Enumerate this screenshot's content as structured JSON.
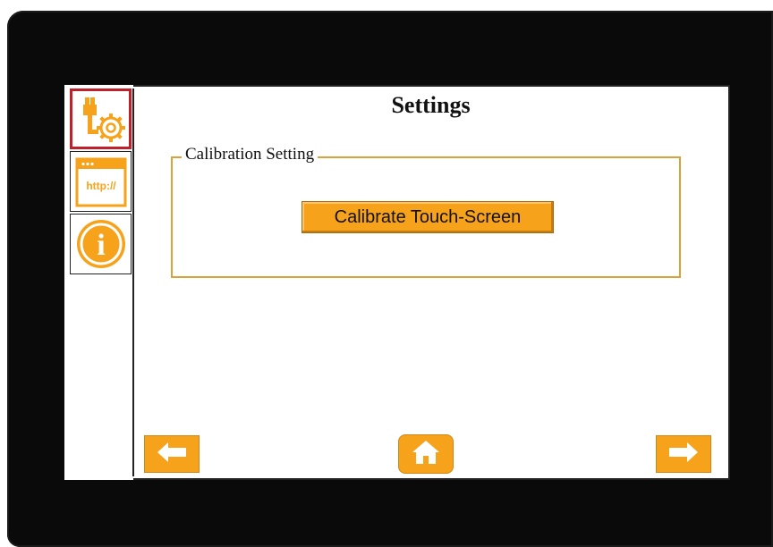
{
  "screen": {
    "title": "Settings"
  },
  "sidebar": {
    "items": [
      {
        "id": "settings",
        "icon": "settings-gear-icon",
        "active": true
      },
      {
        "id": "network",
        "icon": "browser-window-icon",
        "label": "http://",
        "active": false
      },
      {
        "id": "info",
        "icon": "info-icon",
        "label": "i",
        "active": false
      }
    ]
  },
  "calibration": {
    "group_label": "Calibration Setting",
    "button_label": "Calibrate Touch-Screen"
  },
  "navigation": {
    "back_icon": "arrow-left-icon",
    "home_icon": "home-icon",
    "next_icon": "arrow-right-icon"
  },
  "colors": {
    "accent": "#f7a21b",
    "active_border": "#c0202a",
    "group_border": "#d9a23a",
    "bezel": "#0a0a0a"
  }
}
